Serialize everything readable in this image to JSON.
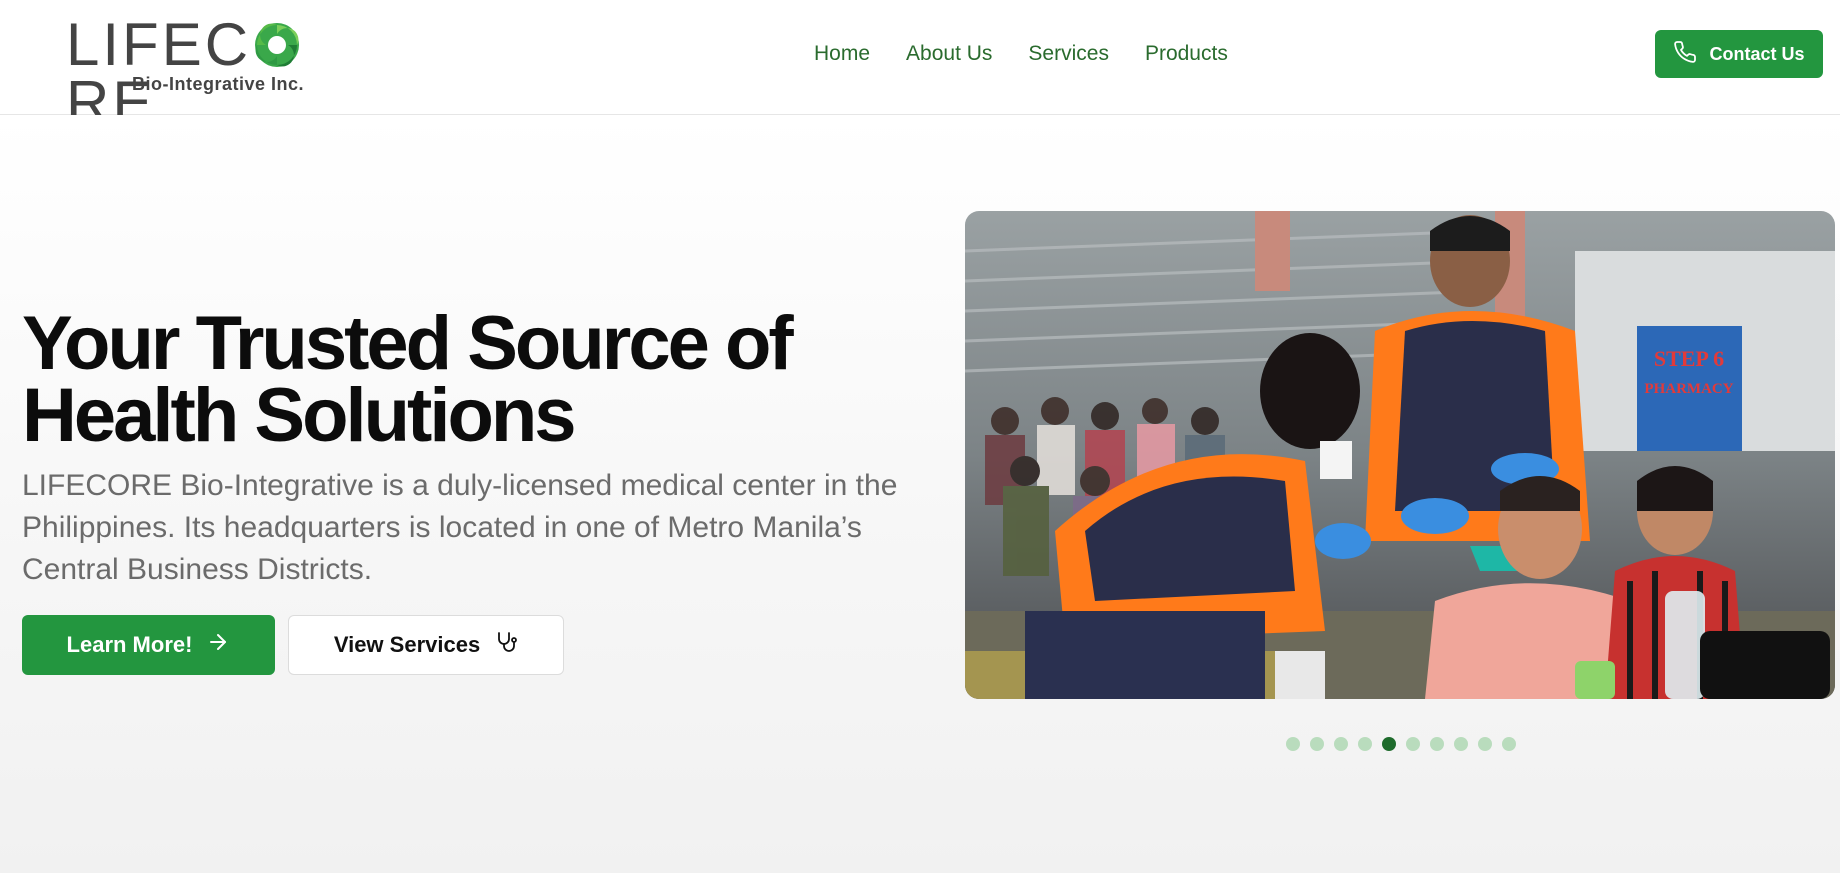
{
  "brand": {
    "name_part1": "LIF",
    "name_part2": "EC",
    "name_part3": "RE",
    "subtitle": "Bio-Integrative Inc."
  },
  "nav": {
    "items": [
      "Home",
      "About Us",
      "Services",
      "Products"
    ]
  },
  "header": {
    "contact_label": "Contact Us"
  },
  "hero": {
    "title_line1": "Your Trusted Source of",
    "title_line2": "Health Solutions",
    "description": "LIFECORE Bio-Integrative is a duly-licensed medical center in the Philippines. Its headquarters is located in one of Metro Manila’s Central Business Districts.",
    "learn_more_label": "Learn More!",
    "view_services_label": "View Services",
    "photo_banner_line1": "STEP 6",
    "photo_banner_line2": "PHARMACY"
  },
  "carousel": {
    "slide_count": 10,
    "active_index": 4
  },
  "colors": {
    "accent": "#23963f",
    "nav_text": "#2a6b2e",
    "dot_inactive": "#b9dcbd",
    "dot_active": "#1e6b2c"
  },
  "icons": {
    "phone": "phone-icon",
    "arrow": "arrow-right-icon",
    "stethoscope": "stethoscope-icon"
  }
}
